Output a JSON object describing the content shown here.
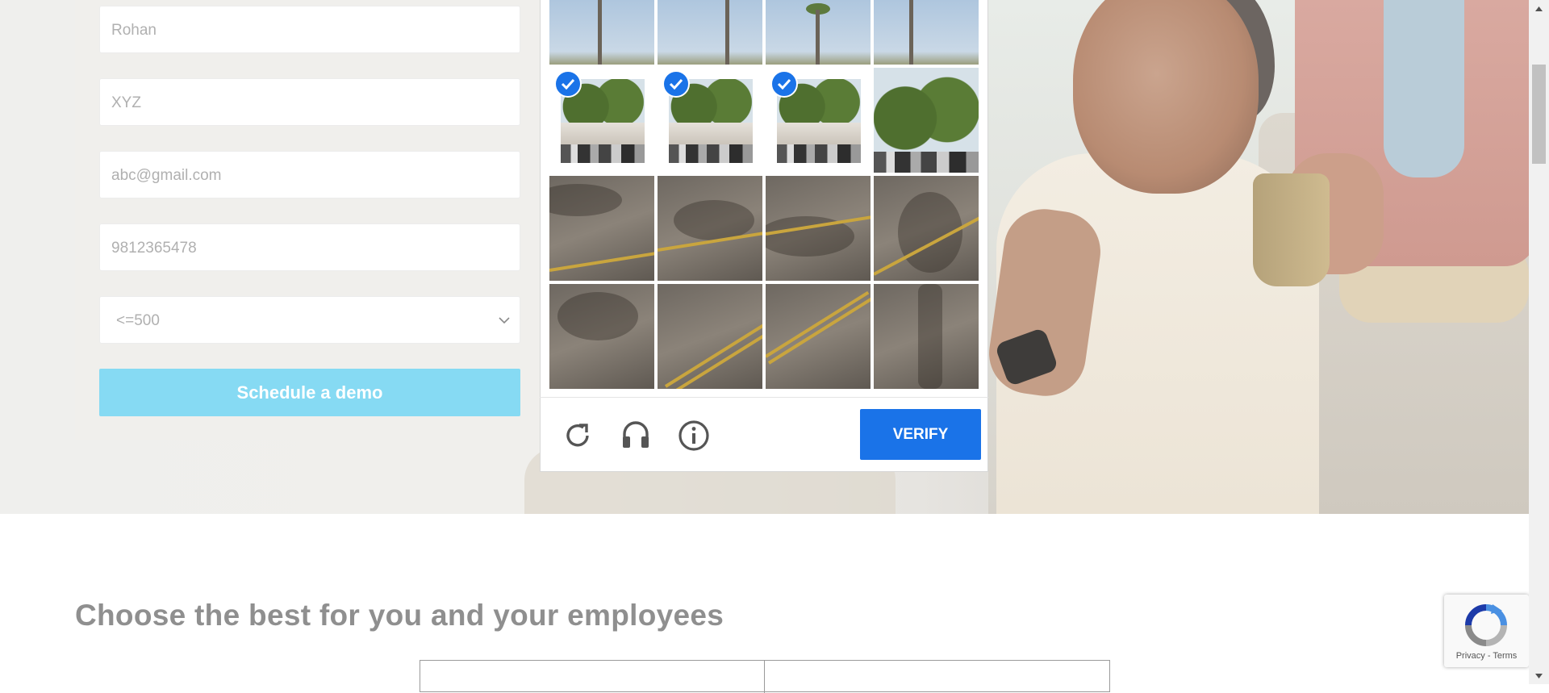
{
  "form": {
    "first_name_value": "Rohan",
    "company_value": "XYZ",
    "email_value": "abc@gmail.com",
    "phone_value": "9812365478",
    "employees_selected": "<=500",
    "submit_label": "Schedule a demo"
  },
  "captcha": {
    "selected_tiles": [
      4,
      5,
      6
    ],
    "verify_label": "VERIFY",
    "reload_icon": "reload-icon",
    "audio_icon": "headphones-icon",
    "info_icon": "info-icon"
  },
  "section": {
    "title": "Choose the best for you and your employees"
  },
  "recaptcha_badge": {
    "links": "Privacy - Terms"
  },
  "colors": {
    "verify": "#1a73e8",
    "submit": "#86daf3",
    "title": "#8f8f8f"
  }
}
